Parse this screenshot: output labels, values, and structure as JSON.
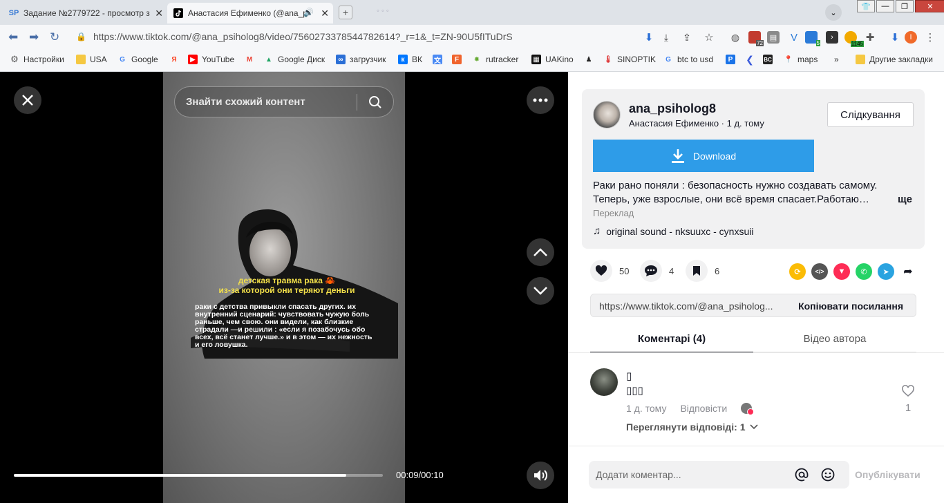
{
  "browser": {
    "tabs": [
      {
        "icon": "SP",
        "label": "Задание №2779722 - просмотр з"
      },
      {
        "icon": "tiktok",
        "label": "Анастасия Ефименко (@ana_p"
      }
    ],
    "url": "https://www.tiktok.com/@ana_psiholog8/video/7560273378544782614?_r=1&_t=ZN-90U5fITuDrS",
    "ext_badges": {
      "b1": "72",
      "b2": "5",
      "b3": "1145"
    },
    "bookmarks": [
      "Настройки",
      "USA",
      "Google",
      "Яндекс",
      "YouTube",
      "Gmail",
      "Google Диск",
      "загрузчик",
      "ВК",
      "",
      "",
      "rutracker",
      "UAKino",
      "",
      "SINOPTIK",
      "btc to usd",
      "",
      "",
      "",
      "maps"
    ],
    "bookmarks_more": "»",
    "other_bookmarks": "Другие закладки"
  },
  "video": {
    "search_placeholder": "Знайти схожий контент",
    "overlay_title_line1": "детская травма рака 🦀",
    "overlay_title_line2": "из-за которой они теряют деньги",
    "overlay_body": "раки с детства привыкли спасать других. их внутренний сценарий: чувствовать чужую боль раньше, чем свою. они видели, как близкие страдали —и решили : «если я позабочусь обо всех, всё станет лучше.» и в этом — их нежность и его ловушка.",
    "time": "00:09/00:10",
    "progress_fraction": 0.9
  },
  "author": {
    "username": "ana_psiholog8",
    "subtitle": "Анастасия Ефименко · 1 д. тому",
    "follow_label": "Слідкування",
    "download_label": "Download",
    "description_line1": "Раки рано поняли : безопасность нужно создавать самому.",
    "description_line2": "Теперь, уже взрослые, они всё время спасает.Работаю…",
    "more_label": "ще",
    "translate_label": "Переклад",
    "sound": "original sound - nksuuxc - cynxsuii"
  },
  "stats": {
    "likes": "50",
    "comments": "4",
    "saves": "6"
  },
  "share_colors": {
    "repost": "#fbbc05",
    "embed": "#555555",
    "send": "#fe2c55",
    "whatsapp": "#25d366",
    "telegram": "#2aa3e0"
  },
  "link": {
    "url": "https://www.tiktok.com/@ana_psiholog...",
    "copy_label": "Копіювати посилання"
  },
  "tabs": {
    "comments": "Коментарі (4)",
    "creator": "Відео автора"
  },
  "comment": {
    "name": "▯",
    "text": "▯▯▯",
    "time": "1 д. тому",
    "reply": "Відповісти",
    "view_replies": "Переглянути відповіді: 1",
    "likes": "1"
  },
  "composer": {
    "placeholder": "Додати коментар...",
    "publish": "Опублікувати"
  }
}
